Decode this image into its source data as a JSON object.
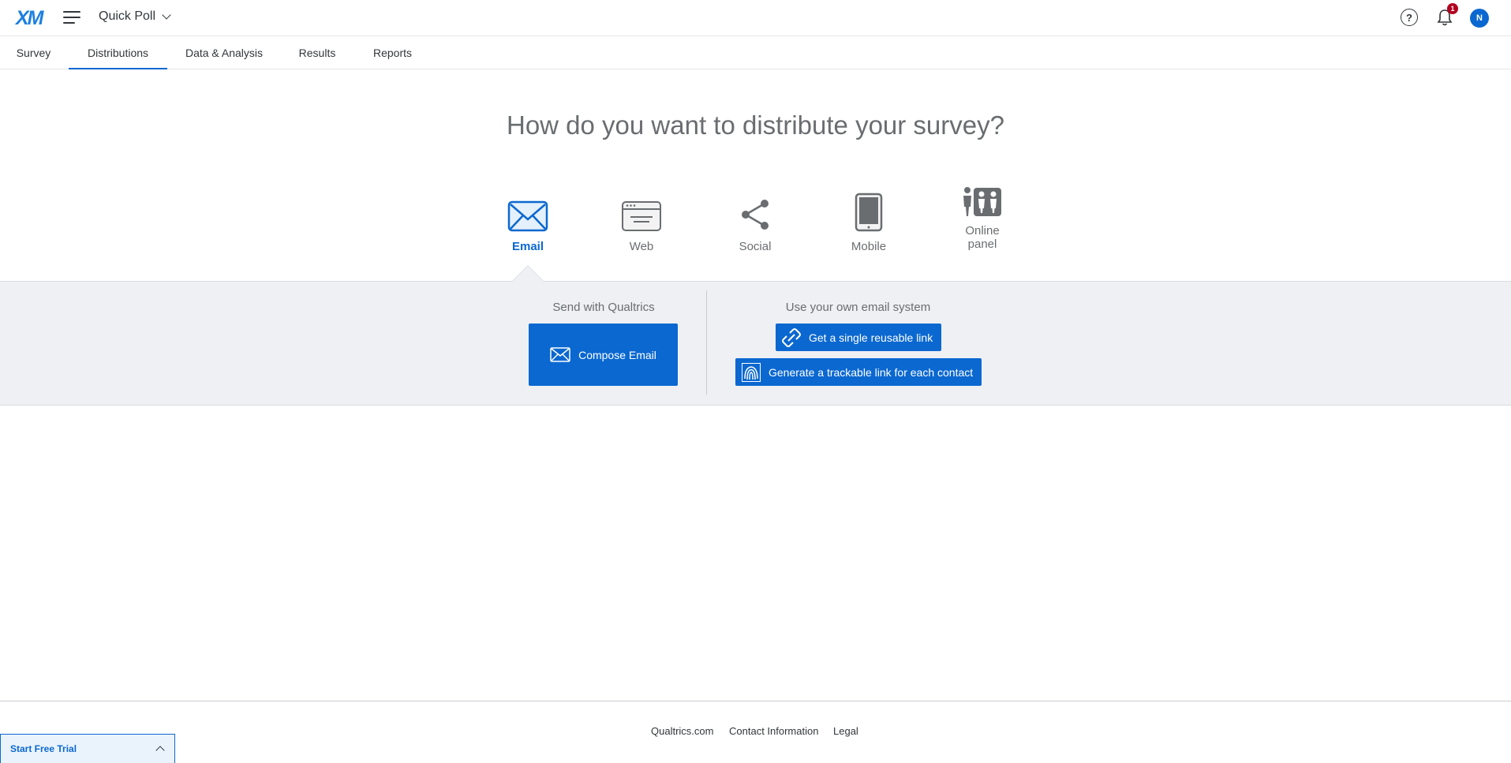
{
  "app": {
    "logo": "XM",
    "project_name": "Quick Poll",
    "notification_count": "1",
    "user_initial": "N"
  },
  "nav": {
    "tabs": [
      {
        "label": "Survey"
      },
      {
        "label": "Distributions",
        "active": true
      },
      {
        "label": "Data & Analysis"
      },
      {
        "label": "Results"
      },
      {
        "label": "Reports"
      }
    ]
  },
  "main": {
    "heading": "How do you want to distribute your survey?",
    "methods": [
      {
        "label": "Email",
        "icon": "email-icon",
        "active": true
      },
      {
        "label": "Web",
        "icon": "web-icon"
      },
      {
        "label": "Social",
        "icon": "share-icon"
      },
      {
        "label": "Mobile",
        "icon": "mobile-icon"
      },
      {
        "label": "Online panel",
        "icon": "people-icon"
      }
    ]
  },
  "email_panel": {
    "qualtrics_title": "Send with Qualtrics",
    "compose_label": "Compose Email",
    "own_title": "Use your own email system",
    "reusable_link_label": "Get a single reusable link",
    "trackable_link_label": "Generate a trackable link for each contact"
  },
  "footer": {
    "links": [
      "Qualtrics.com",
      "Contact Information",
      "Legal"
    ],
    "trial_label": "Start Free Trial"
  },
  "colors": {
    "accent": "#0b68d0",
    "badge": "#b2001f",
    "panel_bg": "#eef0f4"
  }
}
